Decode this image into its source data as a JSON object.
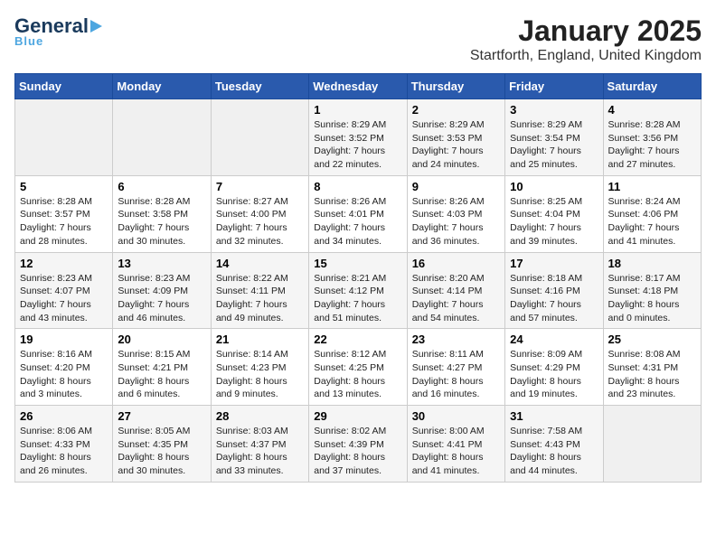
{
  "header": {
    "logo_main": "General",
    "logo_sub": "Blue",
    "title": "January 2025",
    "subtitle": "Startforth, England, United Kingdom"
  },
  "weekdays": [
    "Sunday",
    "Monday",
    "Tuesday",
    "Wednesday",
    "Thursday",
    "Friday",
    "Saturday"
  ],
  "weeks": [
    [
      {
        "day": "",
        "info": ""
      },
      {
        "day": "",
        "info": ""
      },
      {
        "day": "",
        "info": ""
      },
      {
        "day": "1",
        "info": "Sunrise: 8:29 AM\nSunset: 3:52 PM\nDaylight: 7 hours\nand 22 minutes."
      },
      {
        "day": "2",
        "info": "Sunrise: 8:29 AM\nSunset: 3:53 PM\nDaylight: 7 hours\nand 24 minutes."
      },
      {
        "day": "3",
        "info": "Sunrise: 8:29 AM\nSunset: 3:54 PM\nDaylight: 7 hours\nand 25 minutes."
      },
      {
        "day": "4",
        "info": "Sunrise: 8:28 AM\nSunset: 3:56 PM\nDaylight: 7 hours\nand 27 minutes."
      }
    ],
    [
      {
        "day": "5",
        "info": "Sunrise: 8:28 AM\nSunset: 3:57 PM\nDaylight: 7 hours\nand 28 minutes."
      },
      {
        "day": "6",
        "info": "Sunrise: 8:28 AM\nSunset: 3:58 PM\nDaylight: 7 hours\nand 30 minutes."
      },
      {
        "day": "7",
        "info": "Sunrise: 8:27 AM\nSunset: 4:00 PM\nDaylight: 7 hours\nand 32 minutes."
      },
      {
        "day": "8",
        "info": "Sunrise: 8:26 AM\nSunset: 4:01 PM\nDaylight: 7 hours\nand 34 minutes."
      },
      {
        "day": "9",
        "info": "Sunrise: 8:26 AM\nSunset: 4:03 PM\nDaylight: 7 hours\nand 36 minutes."
      },
      {
        "day": "10",
        "info": "Sunrise: 8:25 AM\nSunset: 4:04 PM\nDaylight: 7 hours\nand 39 minutes."
      },
      {
        "day": "11",
        "info": "Sunrise: 8:24 AM\nSunset: 4:06 PM\nDaylight: 7 hours\nand 41 minutes."
      }
    ],
    [
      {
        "day": "12",
        "info": "Sunrise: 8:23 AM\nSunset: 4:07 PM\nDaylight: 7 hours\nand 43 minutes."
      },
      {
        "day": "13",
        "info": "Sunrise: 8:23 AM\nSunset: 4:09 PM\nDaylight: 7 hours\nand 46 minutes."
      },
      {
        "day": "14",
        "info": "Sunrise: 8:22 AM\nSunset: 4:11 PM\nDaylight: 7 hours\nand 49 minutes."
      },
      {
        "day": "15",
        "info": "Sunrise: 8:21 AM\nSunset: 4:12 PM\nDaylight: 7 hours\nand 51 minutes."
      },
      {
        "day": "16",
        "info": "Sunrise: 8:20 AM\nSunset: 4:14 PM\nDaylight: 7 hours\nand 54 minutes."
      },
      {
        "day": "17",
        "info": "Sunrise: 8:18 AM\nSunset: 4:16 PM\nDaylight: 7 hours\nand 57 minutes."
      },
      {
        "day": "18",
        "info": "Sunrise: 8:17 AM\nSunset: 4:18 PM\nDaylight: 8 hours\nand 0 minutes."
      }
    ],
    [
      {
        "day": "19",
        "info": "Sunrise: 8:16 AM\nSunset: 4:20 PM\nDaylight: 8 hours\nand 3 minutes."
      },
      {
        "day": "20",
        "info": "Sunrise: 8:15 AM\nSunset: 4:21 PM\nDaylight: 8 hours\nand 6 minutes."
      },
      {
        "day": "21",
        "info": "Sunrise: 8:14 AM\nSunset: 4:23 PM\nDaylight: 8 hours\nand 9 minutes."
      },
      {
        "day": "22",
        "info": "Sunrise: 8:12 AM\nSunset: 4:25 PM\nDaylight: 8 hours\nand 13 minutes."
      },
      {
        "day": "23",
        "info": "Sunrise: 8:11 AM\nSunset: 4:27 PM\nDaylight: 8 hours\nand 16 minutes."
      },
      {
        "day": "24",
        "info": "Sunrise: 8:09 AM\nSunset: 4:29 PM\nDaylight: 8 hours\nand 19 minutes."
      },
      {
        "day": "25",
        "info": "Sunrise: 8:08 AM\nSunset: 4:31 PM\nDaylight: 8 hours\nand 23 minutes."
      }
    ],
    [
      {
        "day": "26",
        "info": "Sunrise: 8:06 AM\nSunset: 4:33 PM\nDaylight: 8 hours\nand 26 minutes."
      },
      {
        "day": "27",
        "info": "Sunrise: 8:05 AM\nSunset: 4:35 PM\nDaylight: 8 hours\nand 30 minutes."
      },
      {
        "day": "28",
        "info": "Sunrise: 8:03 AM\nSunset: 4:37 PM\nDaylight: 8 hours\nand 33 minutes."
      },
      {
        "day": "29",
        "info": "Sunrise: 8:02 AM\nSunset: 4:39 PM\nDaylight: 8 hours\nand 37 minutes."
      },
      {
        "day": "30",
        "info": "Sunrise: 8:00 AM\nSunset: 4:41 PM\nDaylight: 8 hours\nand 41 minutes."
      },
      {
        "day": "31",
        "info": "Sunrise: 7:58 AM\nSunset: 4:43 PM\nDaylight: 8 hours\nand 44 minutes."
      },
      {
        "day": "",
        "info": ""
      }
    ]
  ]
}
